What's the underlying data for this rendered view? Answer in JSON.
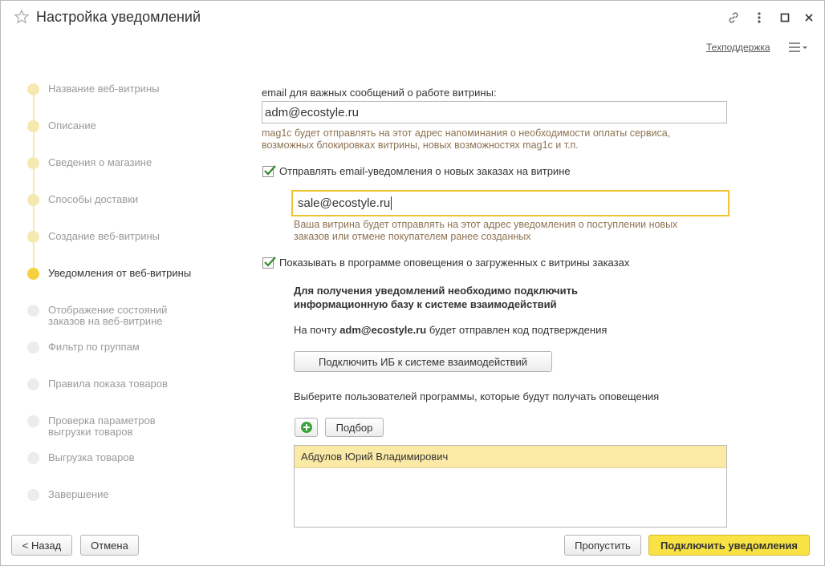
{
  "window": {
    "title": "Настройка уведомлений",
    "support_link": "Техподдержка"
  },
  "steps": [
    {
      "label": "Название веб-витрины",
      "state": "done"
    },
    {
      "label": "Описание",
      "state": "done"
    },
    {
      "label": "Сведения о магазине",
      "state": "done"
    },
    {
      "label": "Способы доставки",
      "state": "done"
    },
    {
      "label": "Создание веб-витрины",
      "state": "done"
    },
    {
      "label": "Уведомления от веб-витрины",
      "state": "active"
    },
    {
      "label": "Отображение состояний заказов на веб-витрине",
      "state": "future"
    },
    {
      "label": "Фильтр по группам",
      "state": "future"
    },
    {
      "label": "Правила показа товаров",
      "state": "future"
    },
    {
      "label": "Проверка параметров выгрузки товаров",
      "state": "future"
    },
    {
      "label": "Выгрузка товаров",
      "state": "future"
    },
    {
      "label": "Завершение",
      "state": "future"
    }
  ],
  "form": {
    "important_email_label": "email для важных сообщений о работе витрины:",
    "important_email_value": "adm@ecostyle.ru",
    "important_email_hint_1": "mag1c будет отправлять на этот адрес напоминания о необходимости оплаты сервиса,",
    "important_email_hint_2": "возможных блокировках витрины, новых возможностях mag1c и т.п.",
    "orders_email_checkbox_label": "Отправлять email-уведомления о новых заказах на витрине",
    "orders_email_checked": true,
    "orders_email_value": "sale@ecostyle.ru",
    "orders_email_hint_1": "Ваша витрина будет отправлять на этот адрес уведомления о поступлении новых",
    "orders_email_hint_2": "заказов или отмене покупателем ранее созданных",
    "show_alerts_checkbox_label": "Показывать в программе оповещения о загруженных с витрины заказах",
    "show_alerts_checked": true,
    "connect_heading_1": "Для получения уведомлений необходимо подключить",
    "connect_heading_2": "информационную базу к системе взаимодействий",
    "code_note_prefix": "На почту ",
    "code_note_email": "adm@ecostyle.ru",
    "code_note_suffix": " будет отправлен код подтверждения",
    "connect_button": "Подключить ИБ к системе взаимодействий",
    "users_label": "Выберите пользователей программы, которые будут получать оповещения",
    "pick_button": "Подбор",
    "users": [
      "Абдулов Юрий Владимирович"
    ]
  },
  "footer": {
    "back_button": "< Назад",
    "cancel_button": "Отмена",
    "skip_button": "Пропустить",
    "submit_button": "Подключить уведомления"
  },
  "colors": {
    "accent": "#f8e244",
    "step_done": "#f6e9b0",
    "step_active": "#f5d23c",
    "step_future": "#ececec",
    "hint_text": "#8d7353",
    "check_mark": "#2e8b2e",
    "add_icon": "#3aa53a"
  }
}
